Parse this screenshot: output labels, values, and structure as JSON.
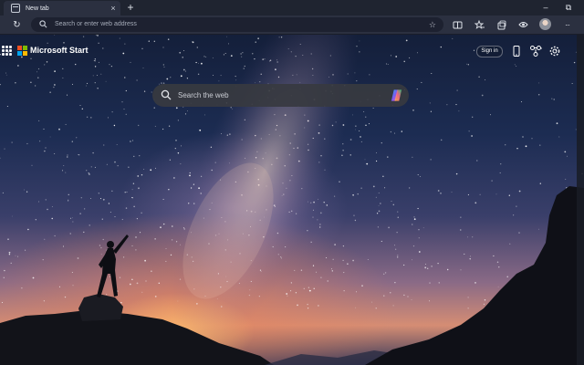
{
  "browser": {
    "tab": {
      "title": "New tab",
      "close_glyph": "×",
      "icon": "newtab-page-icon"
    },
    "new_tab_glyph": "+",
    "window": {
      "minimize_glyph": "–",
      "restore_glyph": "⧉"
    },
    "toolbar": {
      "refresh_glyph": "↻",
      "address_placeholder": "Search or enter web address",
      "favorite_glyph": "☆",
      "menu_glyph": "···"
    }
  },
  "page": {
    "brand": "Microsoft Start",
    "signin_label": "Sign in",
    "search_placeholder": "Search the web",
    "background": "Milky Way night sky with person silhouette on rocks",
    "colors": {
      "sky_top": "#141f3a",
      "horizon_glow": "#d58d74",
      "search_box": "#373a40"
    }
  }
}
